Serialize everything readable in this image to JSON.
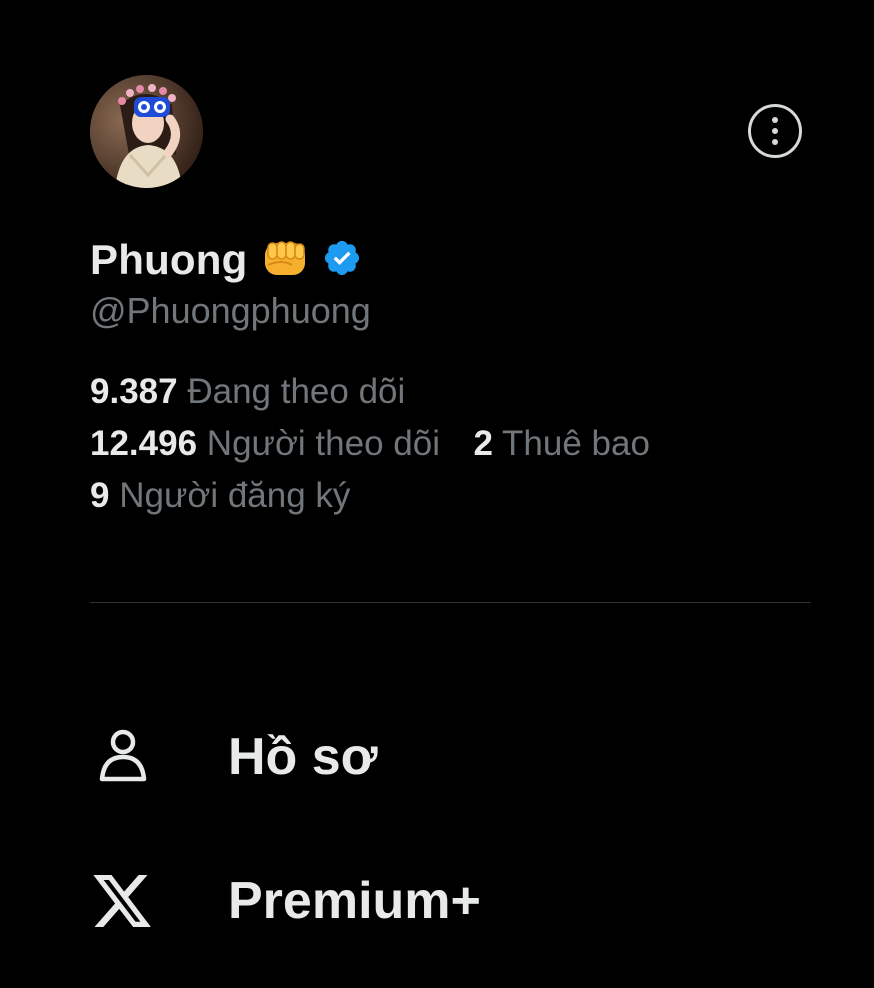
{
  "profile": {
    "name": "Phuong",
    "handle": "@Phuongphuong",
    "fist_icon": "oncoming-fist-icon",
    "verified_icon": "verified-badge-icon",
    "verified_color": "#1d9bf0"
  },
  "stats": {
    "following_count": "9.387",
    "following_label": "Đang theo dõi",
    "followers_count": "12.496",
    "followers_label": "Người theo dõi",
    "subscriptions_count": "2",
    "subscriptions_label": "Thuê bao",
    "subscribers_count": "9",
    "subscribers_label": "Người đăng ký"
  },
  "menu": [
    {
      "label": "Hồ sơ",
      "icon": "person-icon"
    },
    {
      "label": "Premium+",
      "icon": "x-logo-icon"
    }
  ],
  "colors": {
    "background": "#000000",
    "primary_text": "#e7e9ea",
    "secondary_text": "#71767b",
    "divider": "#2f3336"
  }
}
